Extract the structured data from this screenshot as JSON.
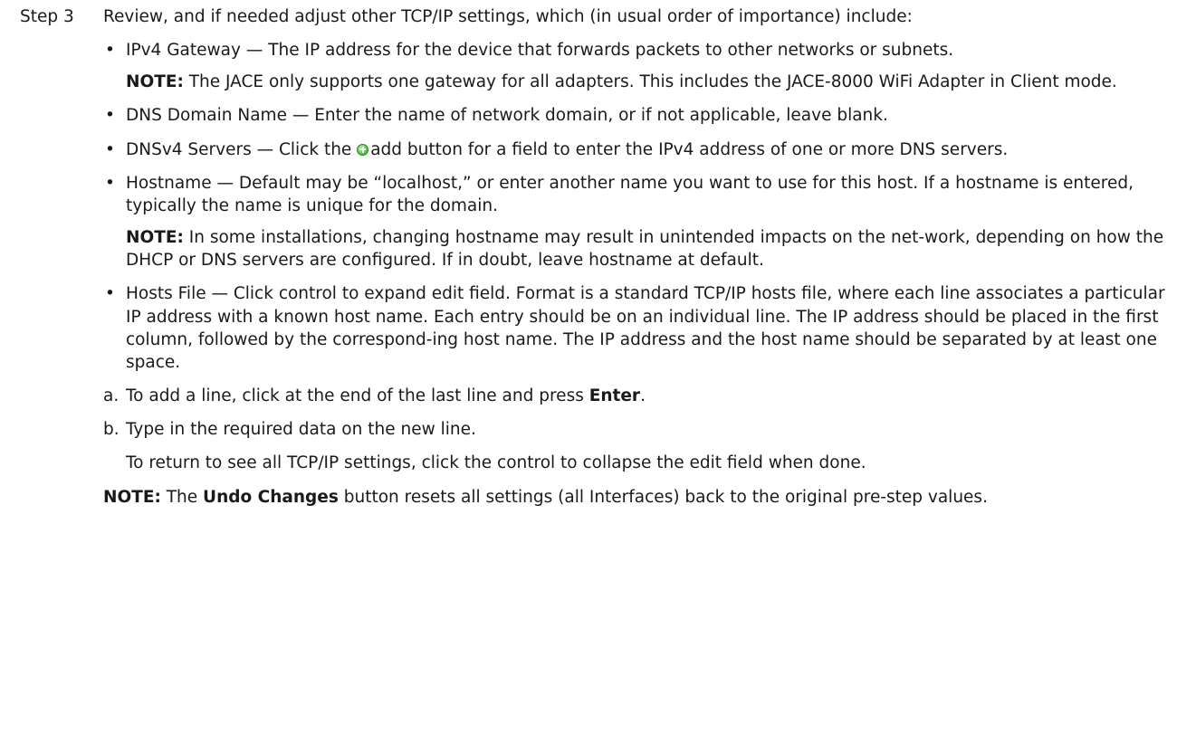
{
  "step": {
    "label": "Step 3",
    "intro": "Review, and if needed adjust other TCP/IP settings, which (in usual order of importance) include:"
  },
  "bullet_symbol": "•",
  "items": {
    "gateway": {
      "text": "IPv4 Gateway — The IP address for the device that forwards packets to other networks or subnets.",
      "note_label": "NOTE:",
      "note_text": " The JACE only supports one gateway for all adapters. This includes the JACE-8000 WiFi Adapter in Client mode."
    },
    "dns_domain": {
      "text": "DNS Domain Name —  Enter the name of network domain, or if not applicable, leave blank."
    },
    "dns_servers": {
      "text_before": "DNSv4 Servers —  Click the ",
      "icon": "add-icon",
      "text_after": "add button for a field to enter the IPv4 address of one or more DNS servers."
    },
    "hostname": {
      "text": "Hostname — Default may be “localhost,” or enter another name you want to use for this host. If a hostname is entered, typically the name is unique for the domain.",
      "note_label": "NOTE:",
      "note_text": " In some installations, changing hostname may result in unintended impacts on the net-work, depending on how the DHCP or DNS servers are configured. If in doubt, leave hostname at default."
    },
    "hosts_file": {
      "text": "Hosts File — Click control to expand edit field. Format is a standard TCP/IP hosts file, where each line associates a particular IP address with a known host name. Each entry should be on an individual line. The IP address should be placed in the first column, followed by the correspond-ing host name. The IP address and the host name should be separated by at least one space."
    }
  },
  "substeps": {
    "a": {
      "marker": "a.",
      "text": "To add a line, click at the end of the last line and press ",
      "bold": "Enter",
      "end": "."
    },
    "b": {
      "marker": "b.",
      "text": "Type in the required data on the new line."
    },
    "return_text": "To return to see all TCP/IP settings, click the control to collapse the edit field when done."
  },
  "final_note": {
    "label": "NOTE:",
    "text_before": " The ",
    "bold": "Undo Changes",
    "text_after": " button resets all settings (all Interfaces) back to the original pre-step values."
  },
  "colors": {
    "text": "#1a1a1a",
    "add_icon": "#55c447"
  }
}
